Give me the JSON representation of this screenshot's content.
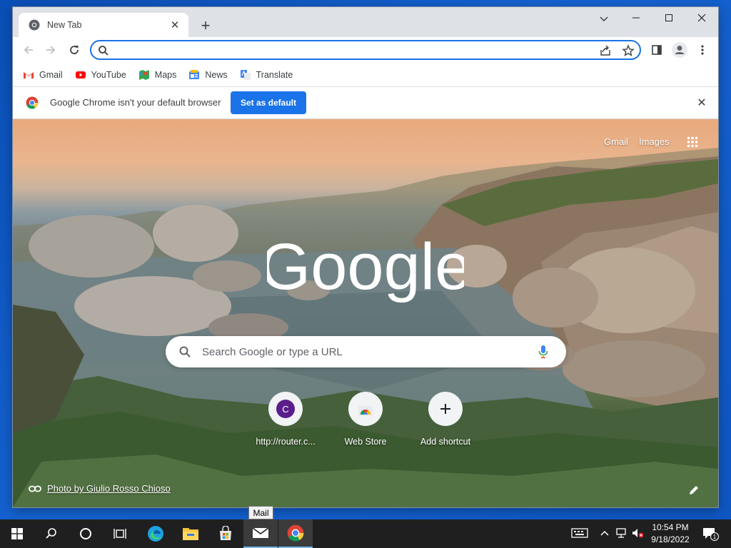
{
  "window": {
    "tab_title": "New Tab",
    "omnibox": {
      "value": "",
      "placeholder": ""
    }
  },
  "bookmarks": [
    {
      "label": "Gmail",
      "icon": "gmail-icon"
    },
    {
      "label": "YouTube",
      "icon": "youtube-icon"
    },
    {
      "label": "Maps",
      "icon": "maps-icon"
    },
    {
      "label": "News",
      "icon": "news-icon"
    },
    {
      "label": "Translate",
      "icon": "translate-icon"
    }
  ],
  "infobar": {
    "message": "Google Chrome isn't your default browser",
    "button": "Set as default"
  },
  "ntp": {
    "links": {
      "gmail": "Gmail",
      "images": "Images"
    },
    "logo_text": "Google",
    "search_placeholder": "Search Google or type a URL",
    "shortcuts": [
      {
        "label": "http://router.c...",
        "letter": "C",
        "icon": "letter-c-icon"
      },
      {
        "label": "Web Store",
        "icon": "webstore-icon"
      },
      {
        "label": "Add shortcut",
        "icon": "plus-icon"
      }
    ],
    "photo_credit": "Photo by Giulio Rosso Chioso"
  },
  "tooltip": "Mail",
  "taskbar": {
    "apps": [
      "start-icon",
      "search-icon",
      "cortana-icon",
      "task-view-icon",
      "edge-icon",
      "file-explorer-icon",
      "store-icon",
      "mail-icon",
      "chrome-icon"
    ],
    "time": "10:54 PM",
    "date": "9/18/2022",
    "notification_count": "1"
  },
  "colors": {
    "accent": "#1a73e8",
    "taskbar": "#1f1f1f",
    "desktop": "#0a4fb6"
  }
}
